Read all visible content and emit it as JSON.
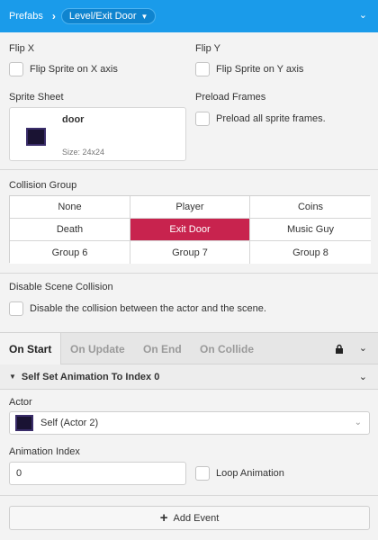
{
  "topbar": {
    "crumb": "Prefabs",
    "separator_icon": "chevron-right-icon",
    "pill_label": "Level/Exit Door",
    "pill_icon": "chevron-down-icon",
    "menu_icon": "chevron-down-icon",
    "background": "#1a9bea"
  },
  "flip_x": {
    "label": "Flip X",
    "checkbox_label": "Flip Sprite on X axis",
    "checked": false
  },
  "flip_y": {
    "label": "Flip Y",
    "checkbox_label": "Flip Sprite on Y axis",
    "checked": false
  },
  "sprite_sheet": {
    "label": "Sprite Sheet",
    "name": "door",
    "size": "Size:  24x24"
  },
  "preload": {
    "label": "Preload Frames",
    "checkbox_label": "Preload all sprite frames.",
    "checked": false
  },
  "collision_group": {
    "label": "Collision Group",
    "options": [
      [
        "None",
        "Player",
        "Coins"
      ],
      [
        "Death",
        "Exit Door",
        "Music Guy"
      ],
      [
        "Group 6",
        "Group 7",
        "Group 8"
      ]
    ],
    "selected": "Exit Door",
    "selected_color": "#c8234e"
  },
  "disable_collision": {
    "label": "Disable Scene Collision",
    "checkbox_label": "Disable the collision between the actor and the scene.",
    "checked": false
  },
  "tabs": {
    "items": [
      "On Start",
      "On Update",
      "On End",
      "On Collide"
    ],
    "active": "On Start",
    "lock_icon": "lock-icon",
    "menu_icon": "chevron-down-icon"
  },
  "event": {
    "title": "Self Set Animation To Index 0",
    "actor_label": "Actor",
    "actor_value": "Self (Actor 2)",
    "animation_index_label": "Animation Index",
    "animation_index_value": "0",
    "loop_label": "Loop Animation",
    "loop_checked": false
  },
  "add_event": {
    "label": "Add Event",
    "icon": "plus-icon"
  }
}
